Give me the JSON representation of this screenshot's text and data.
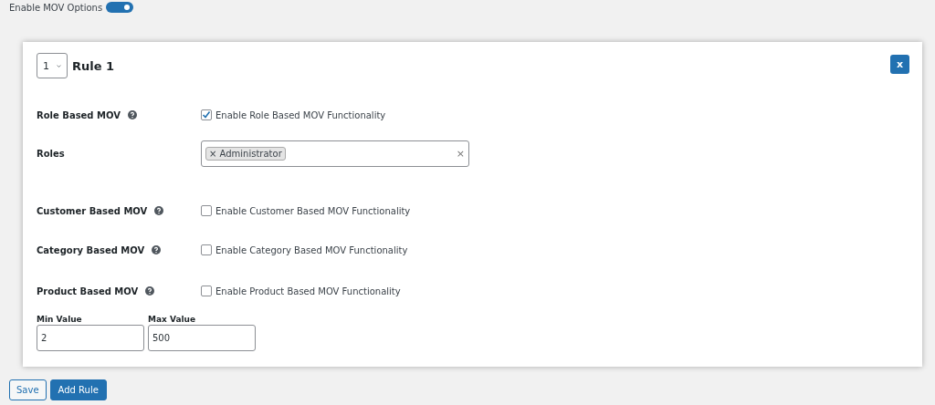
{
  "mov_toggle": {
    "label": "Enable MOV Options",
    "on": true
  },
  "rule": {
    "number": "1",
    "title": "Rule 1",
    "close": "x",
    "rows": [
      {
        "kind": "checkbox",
        "label": "Role Based MOV",
        "help": true,
        "text": "Enable Role Based MOV Functionality",
        "checked": true
      },
      {
        "kind": "tags",
        "label": "Roles",
        "help": false,
        "tags": [
          {
            "remove": "×",
            "text": "Administrator"
          }
        ],
        "clear": "×"
      },
      {
        "kind": "checkbox",
        "label": "Customer Based MOV",
        "help": true,
        "text": "Enable Customer Based MOV Functionality",
        "checked": false
      },
      {
        "kind": "checkbox",
        "label": "Category Based MOV",
        "help": true,
        "text": "Enable Category Based MOV Functionality",
        "checked": false
      },
      {
        "kind": "checkbox",
        "label": "Product Based MOV",
        "help": true,
        "text": "Enable Product Based MOV Functionality",
        "checked": false
      }
    ],
    "values": [
      {
        "label": "Min Value",
        "value": "2"
      },
      {
        "label": "Max Value",
        "value": "500"
      }
    ]
  },
  "buttons": [
    {
      "label": "Save",
      "kind": "secondary"
    },
    {
      "label": "Add Rule",
      "kind": "primary"
    }
  ]
}
